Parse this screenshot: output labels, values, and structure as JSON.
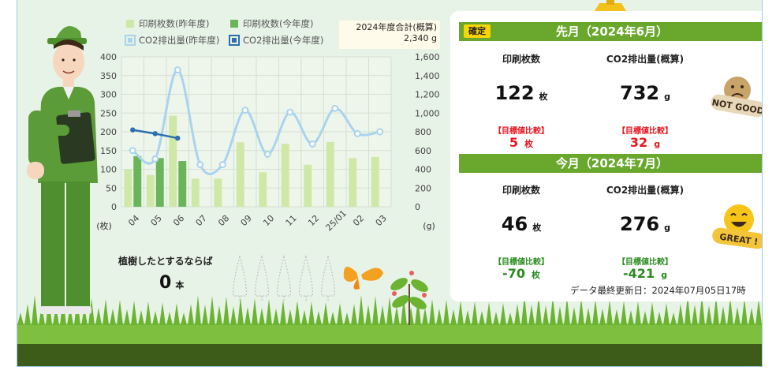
{
  "chart_data": {
    "type": "bar",
    "categories": [
      "04",
      "05",
      "06",
      "07",
      "08",
      "09",
      "10",
      "11",
      "12",
      "25/01",
      "02",
      "03"
    ],
    "y_left": {
      "label": "(枚)",
      "range": [
        0,
        400
      ],
      "ticks": [
        0,
        50,
        100,
        150,
        200,
        250,
        300,
        350,
        400
      ]
    },
    "y_right": {
      "label": "(g)",
      "range": [
        0,
        1600
      ],
      "ticks": [
        "0",
        "200",
        "400",
        "600",
        "800",
        "1,000",
        "1,200",
        "1,400",
        "1,600"
      ]
    },
    "series": [
      {
        "name": "印刷枚数(昨年度)",
        "kind": "bar",
        "axis": "left",
        "color": "#cfe8a8",
        "values": [
          100,
          85,
          243,
          75,
          75,
          172,
          92,
          168,
          112,
          173,
          130,
          133
        ]
      },
      {
        "name": "印刷枚数(今年度)",
        "kind": "bar",
        "axis": "left",
        "color": "#6ab55a",
        "values": [
          135,
          130,
          122
        ]
      },
      {
        "name": "CO2排出量(昨年度)",
        "kind": "line",
        "axis": "right",
        "color": "#a9d3ee",
        "values": [
          600,
          510,
          1460,
          450,
          450,
          1030,
          560,
          1010,
          670,
          1050,
          780,
          800
        ]
      },
      {
        "name": "CO2排出量(今年度)",
        "kind": "line",
        "axis": "right",
        "color": "#2d6fae",
        "values": [
          820,
          780,
          732
        ]
      }
    ],
    "grid": true,
    "legend": "top"
  },
  "total": {
    "title": "2024年度合計(概算)",
    "value": "2,340 g"
  },
  "trees": {
    "label": "植樹したとするならば",
    "count": "0",
    "unit": "本"
  },
  "last_month": {
    "badge": "確定",
    "title": "先月（2024年6月）",
    "print_label": "印刷枚数",
    "co2_label": "CO2排出量(概算)",
    "print_value": "122",
    "print_unit": "枚",
    "co2_value": "732",
    "co2_unit": "g",
    "cmp_label": "【目標値比較】",
    "print_diff": "5",
    "co2_diff": "32",
    "stamp": "NOT GOOD"
  },
  "this_month": {
    "title": "今月（2024年7月）",
    "print_label": "印刷枚数",
    "co2_label": "CO2排出量(概算)",
    "print_value": "46",
    "print_unit": "枚",
    "co2_value": "276",
    "co2_unit": "g",
    "cmp_label": "【目標値比較】",
    "print_diff": "-70",
    "co2_diff": "-421",
    "stamp": "GREAT !"
  },
  "updated": "データ最終更新日：2024年07月05日17時",
  "colors": {
    "panel_head": "#6aa82d",
    "bg": "#e7f3e7",
    "grass": "#5aa02c",
    "soil": "#3a5a1a"
  }
}
